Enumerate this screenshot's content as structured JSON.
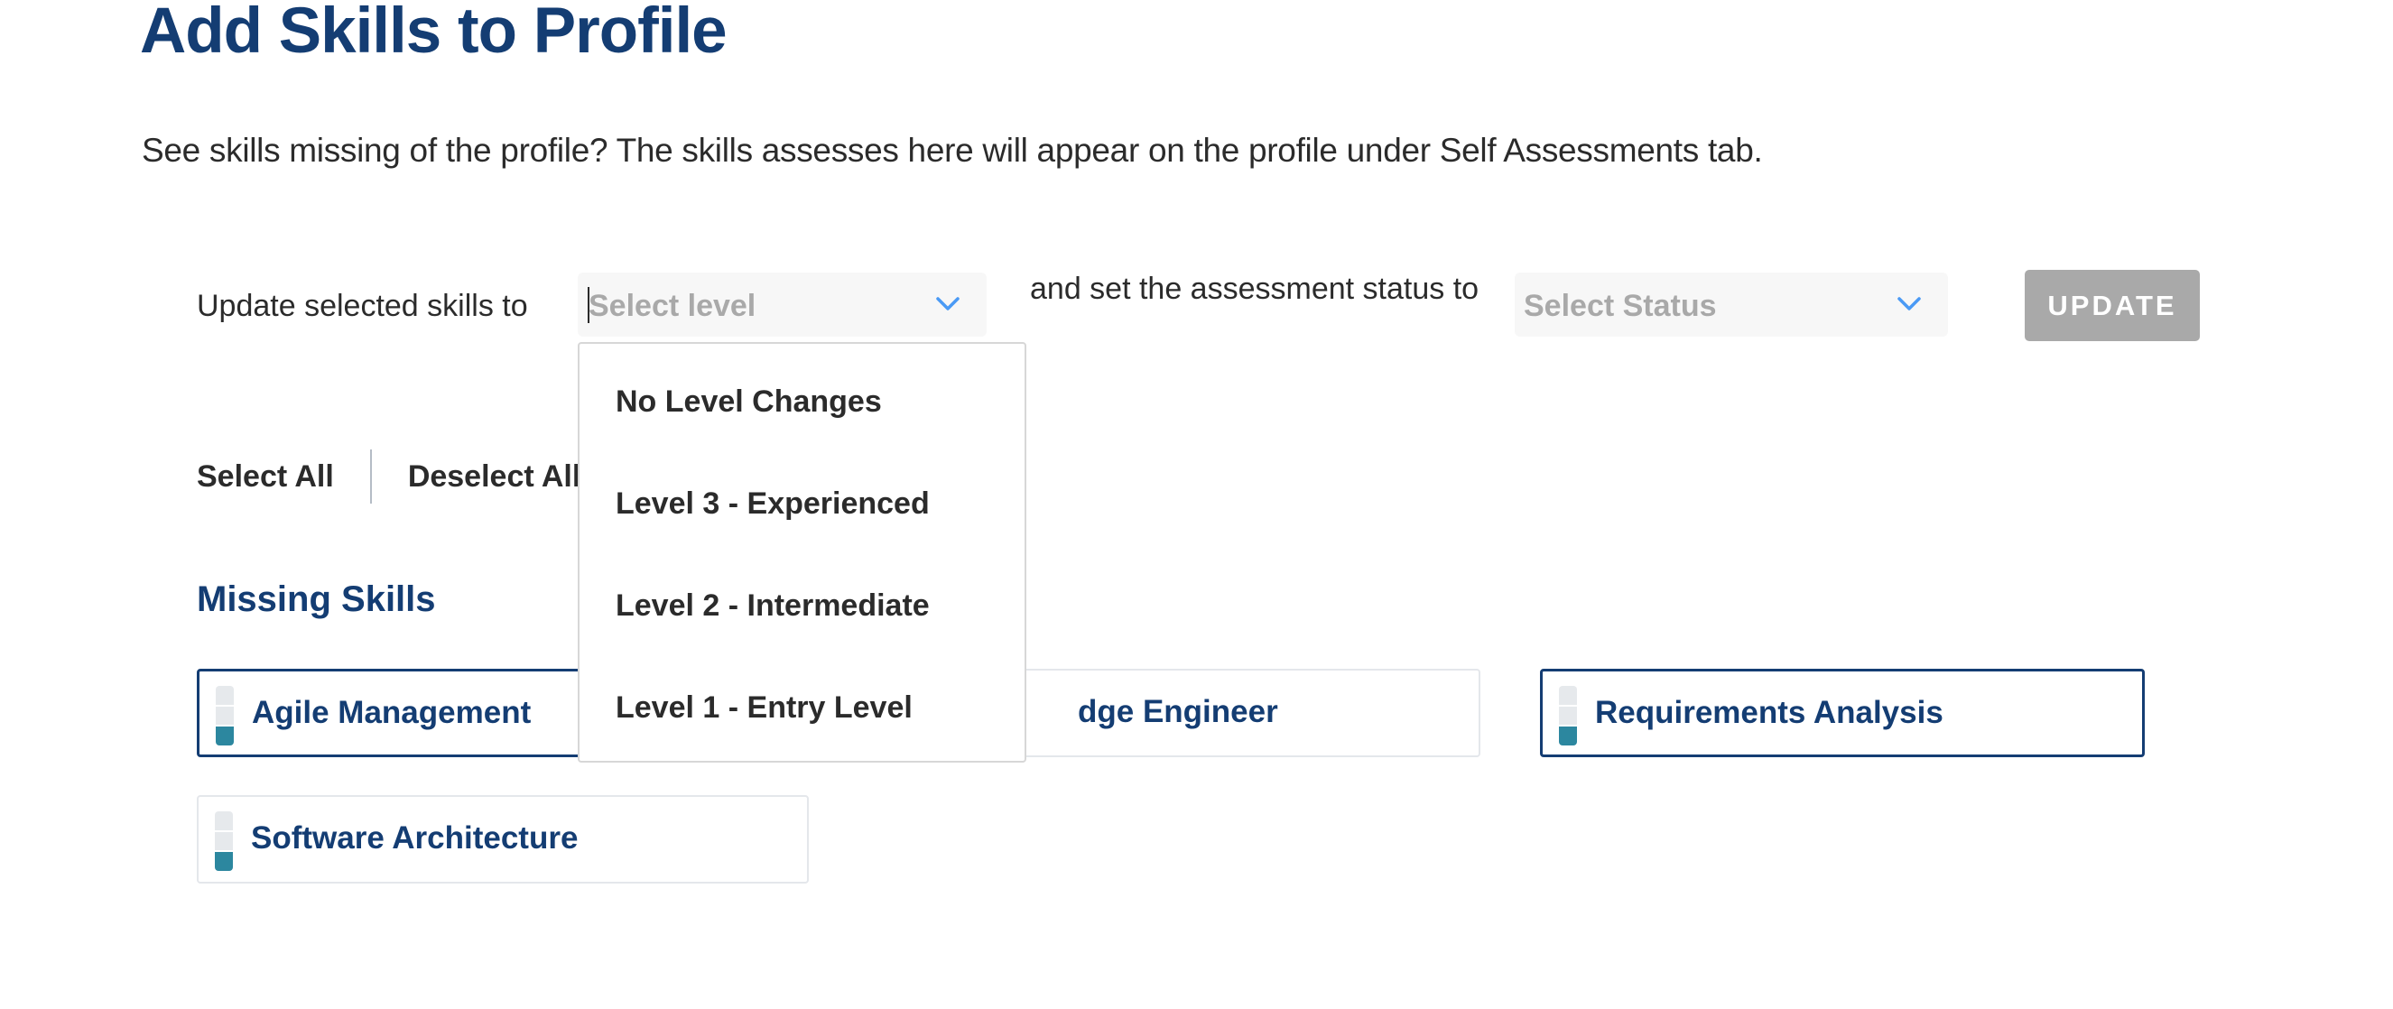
{
  "header": {
    "title": "Add Skills to Profile",
    "description": "See skills missing of the profile? The skills assesses here will appear on the profile under Self Assessments tab."
  },
  "update_bar": {
    "prefix_label": "Update selected skills to",
    "level_select": {
      "placeholder": "Select level",
      "icon": "chevron-down-icon",
      "expanded": true,
      "options": [
        "No Level Changes",
        "Level 3 - Experienced",
        "Level 2 - Intermediate",
        "Level 1 - Entry Level"
      ]
    },
    "middle_label": "and set the assessment status to",
    "status_select": {
      "placeholder": "Select Status",
      "icon": "chevron-down-icon"
    },
    "update_button": {
      "label": "UPDATE",
      "disabled": true
    }
  },
  "bulk_actions": {
    "select_all": "Select All",
    "deselect_all": "Deselect All"
  },
  "missing_skills": {
    "title": "Missing Skills",
    "skills": [
      {
        "name": "Agile Management",
        "selected": true,
        "level": 1,
        "max_level": 3
      },
      {
        "name": "dge Engineer",
        "selected": false,
        "level": null,
        "max_level": 3,
        "partially_hidden": true
      },
      {
        "name": "Requirements Analysis",
        "selected": true,
        "level": 1,
        "max_level": 3
      },
      {
        "name": "Software Architecture",
        "selected": false,
        "level": 1,
        "max_level": 3
      }
    ]
  },
  "colors": {
    "brand_navy": "#143d73",
    "level_fill": "#2c879f",
    "level_empty": "#e6e9ec",
    "chevron": "#4a9af5",
    "disabled_button": "#a9a9a9"
  }
}
